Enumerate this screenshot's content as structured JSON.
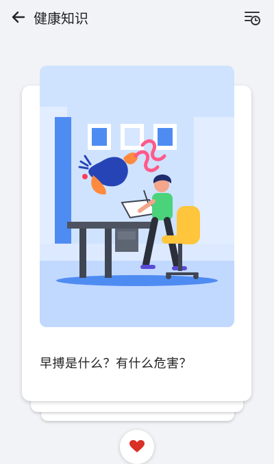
{
  "header": {
    "title": "健康知识",
    "back_icon": "arrow-left-icon",
    "history_icon": "list-clock-icon"
  },
  "card": {
    "text": "早搏是什么？有什么危害？",
    "illustration": "person-drawing-at-desk-illustration"
  },
  "actions": {
    "favorite_icon": "heart-icon",
    "favorite_color": "#d93025"
  },
  "colors": {
    "background": "#f2f3f7",
    "illustration_bg": "#cfe3ff",
    "accent_blue": "#4a8df8"
  }
}
